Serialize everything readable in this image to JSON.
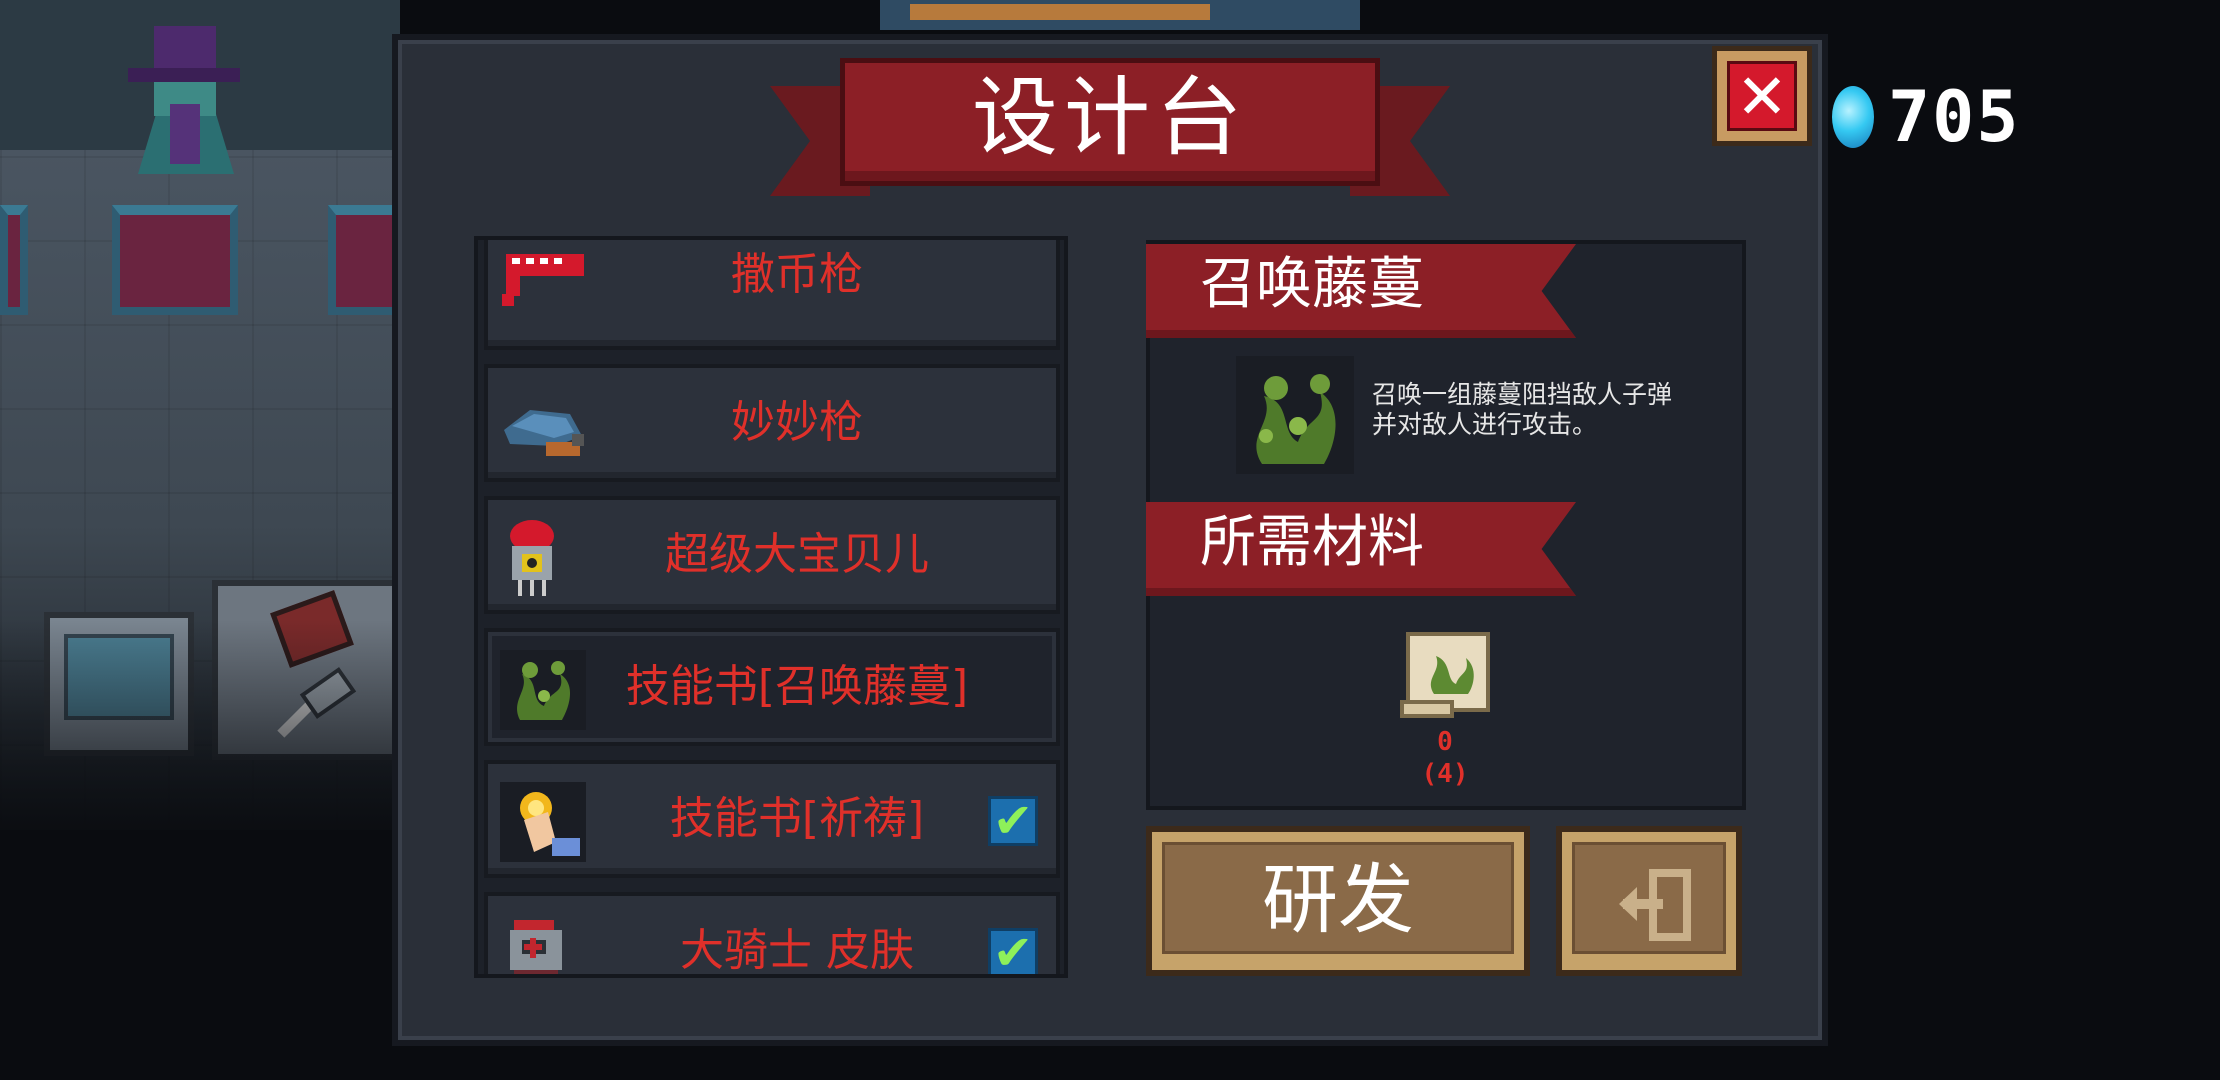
{
  "hud": {
    "gems": "705"
  },
  "dialog": {
    "title": "设计台",
    "close_symbol": "✕"
  },
  "list": {
    "items": [
      {
        "label": "撒币枪",
        "icon": "coin-gun-icon",
        "unlocked": false
      },
      {
        "label": "妙妙枪",
        "icon": "magic-gun-icon",
        "unlocked": false
      },
      {
        "label": "超级大宝贝儿",
        "icon": "super-baby-icon",
        "unlocked": false
      },
      {
        "label": "技能书[召唤藤蔓]",
        "icon": "vine-skillbook-icon",
        "unlocked": false,
        "selected": true
      },
      {
        "label": "技能书[祈祷]",
        "icon": "prayer-skillbook-icon",
        "unlocked": true
      },
      {
        "label": "大骑士 皮肤",
        "icon": "knight-skin-icon",
        "unlocked": true
      }
    ]
  },
  "detail": {
    "name": "召唤藤蔓",
    "description_line1": "召唤一组藤蔓阻挡敌人子弹",
    "description_line2": "并对敌人进行攻击。",
    "materials_header": "所需材料",
    "material": {
      "icon": "vine-scroll-icon",
      "have": "0",
      "need": "(4)"
    }
  },
  "buttons": {
    "research": "研发",
    "exit_icon": "exit-icon"
  },
  "colors": {
    "panel": "#2a2f38",
    "banner_red": "#8c1f26",
    "item_text_red": "#e0302a",
    "button_brown": "#8a6a48",
    "check_green": "#8ef05a"
  }
}
